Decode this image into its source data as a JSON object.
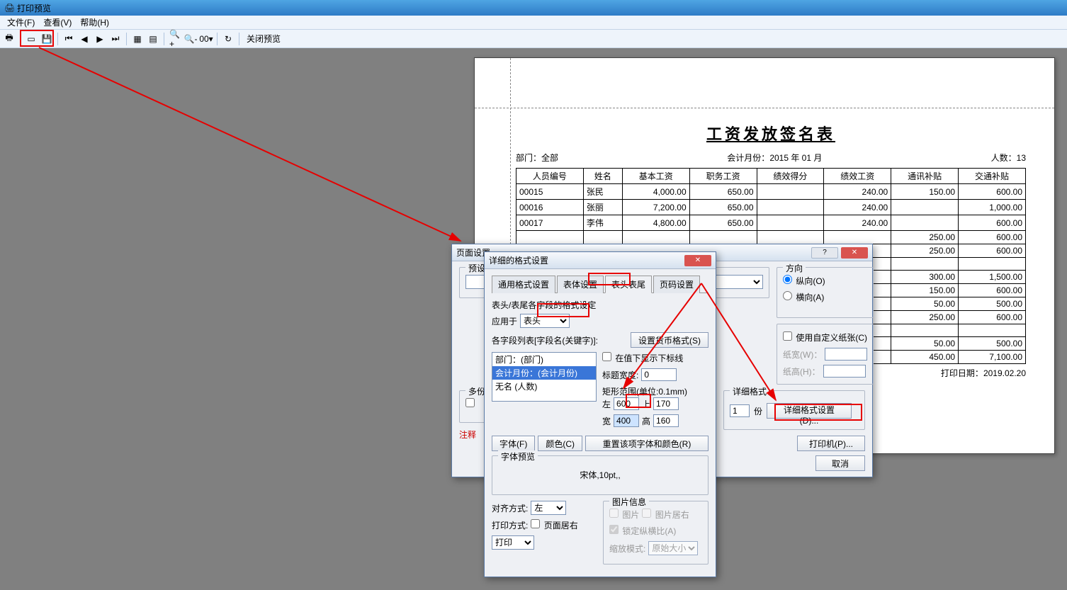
{
  "window": {
    "title": "打印预览"
  },
  "menu": {
    "file": "文件(F)",
    "view": "查看(V)",
    "help": "帮助(H)"
  },
  "toolbar": {
    "close_preview": "关闭预览",
    "zoom_combo": "00"
  },
  "report": {
    "title": "工资发放签名表",
    "dept_label": "部门：",
    "dept_value": "全部",
    "month_label": "会计月份：",
    "month_value": "2015 年 01 月",
    "count_label": "人数：",
    "count_value": "13",
    "headers": [
      "人员编号",
      "姓名",
      "基本工资",
      "职务工资",
      "绩效得分",
      "绩效工资",
      "通讯补贴",
      "交通补贴"
    ],
    "rows": [
      [
        "00015",
        "张民",
        "4,000.00",
        "650.00",
        "",
        "240.00",
        "150.00",
        "600.00"
      ],
      [
        "00016",
        "张丽",
        "7,200.00",
        "650.00",
        "",
        "240.00",
        "",
        "1,000.00"
      ],
      [
        "00017",
        "李伟",
        "4,800.00",
        "650.00",
        "",
        "240.00",
        "",
        "600.00"
      ],
      [
        "",
        "",
        "",
        "",
        "",
        "",
        "250.00",
        "600.00"
      ],
      [
        "",
        "",
        "",
        "",
        "",
        "",
        "250.00",
        "600.00"
      ],
      [
        "",
        "",
        "",
        "",
        "",
        "",
        "",
        ""
      ],
      [
        "",
        "",
        "",
        "",
        "",
        "",
        "300.00",
        "1,500.00"
      ],
      [
        "",
        "",
        "",
        "",
        "",
        "",
        "150.00",
        "600.00"
      ],
      [
        "",
        "",
        "",
        "",
        "",
        "",
        "50.00",
        "500.00"
      ],
      [
        "",
        "",
        "",
        "",
        "",
        "",
        "250.00",
        "600.00"
      ],
      [
        "",
        "",
        "",
        "",
        "",
        "",
        "",
        ""
      ],
      [
        "",
        "",
        "",
        "",
        "",
        "",
        "50.00",
        "500.00"
      ],
      [
        "",
        "",
        "",
        "",
        "",
        "",
        "450.00",
        "7,100.00"
      ]
    ],
    "print_date_label": "打印日期：",
    "print_date_value": "2019.02.20"
  },
  "page_setup_dialog": {
    "title": "页面设置",
    "preset_label": "预设",
    "direction_label": "方向",
    "portrait": "纵向(O)",
    "landscape": "横向(A)",
    "custom_paper": "使用自定义纸张(C)",
    "paper_w": "纸宽(W)：",
    "paper_h": "纸高(H)：",
    "multi_label": "多份",
    "detail_group": "详细格式",
    "copies_value": "1",
    "copies_unit": "份",
    "detail_btn": "详细格式设置(D)...",
    "printer_btn": "打印机(P)...",
    "cancel_btn": "取消",
    "note_prefix": "注释",
    "help": "?"
  },
  "detail_dialog": {
    "title": "详细的格式设置",
    "tabs": {
      "general": "通用格式设置",
      "body": "表体设置",
      "header_footer": "表头表尾",
      "page_no": "页码设置"
    },
    "section_label": "表头/表尾各字段的格式设定",
    "apply_to_label": "应用于",
    "apply_to_value": "表头",
    "field_list_label": "各字段列表[字段名(关键字)]:",
    "currency_btn": "设置货币格式(S)",
    "underline_chk": "在值下显示下标线",
    "list_items": [
      "部门：(部门)",
      "会计月份：(会计月份)",
      "无名 (人数)"
    ],
    "title_width_label": "标题宽度:",
    "title_width_value": "0",
    "rect_label": "矩形范围(单位:0.1mm)",
    "left_label": "左",
    "left_value": "600",
    "top_label": "上",
    "top_value": "170",
    "width_label": "宽",
    "width_value": "400",
    "height_label": "高",
    "height_value": "160",
    "font_btn": "字体(F)",
    "color_btn": "颜色(C)",
    "reset_btn": "重置该项字体和颜色(R)",
    "font_preview_label": "字体预览",
    "font_preview_value": "宋体,10pt,,",
    "align_label": "对齐方式:",
    "align_value": "左",
    "print_mode_label": "打印方式:",
    "page_center": "页面居右",
    "print_value": "打印",
    "image_info_label": "图片信息",
    "image_chk": "图片",
    "image_right": "图片居右",
    "lock_ratio": "锁定纵横比(A)",
    "zoom_mode_label": "缩放模式:",
    "zoom_mode_value": "原始大小"
  }
}
